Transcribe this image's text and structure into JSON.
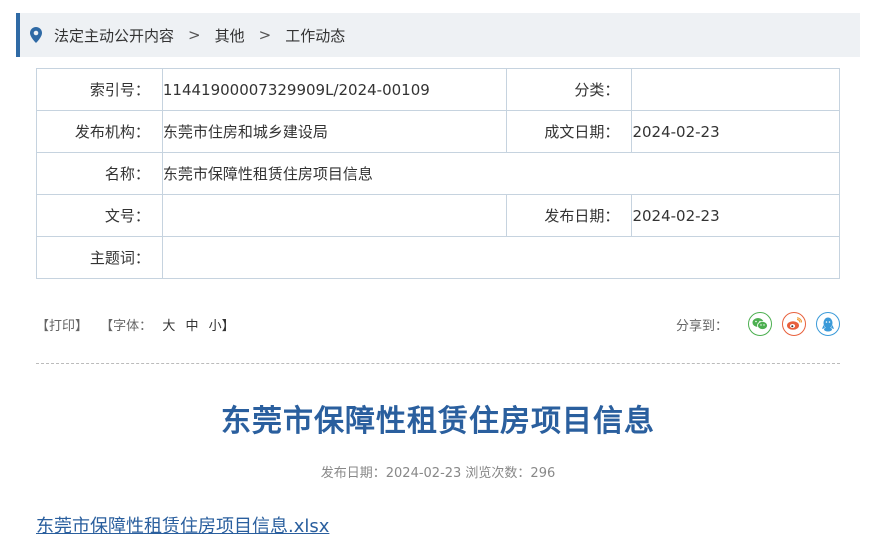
{
  "breadcrumb": {
    "items": [
      "法定主动公开内容",
      "其他",
      "工作动态"
    ],
    "separator": ">"
  },
  "info": {
    "index_label": "索引号：",
    "index_value": "11441900007329909L/2024-00109",
    "category_label": "分类：",
    "category_value": "",
    "publisher_label": "发布机构：",
    "publisher_value": "东莞市住房和城乡建设局",
    "created_label": "成文日期：",
    "created_value": "2024-02-23",
    "name_label": "名称：",
    "name_value": "东莞市保障性租赁住房项目信息",
    "docno_label": "文号：",
    "docno_value": "",
    "pubdate_label": "发布日期：",
    "pubdate_value": "2024-02-23",
    "keywords_label": "主题词：",
    "keywords_value": ""
  },
  "tools": {
    "print": "【打印】",
    "font_open": "【字体：",
    "font_large": "大",
    "font_medium": "中",
    "font_small": "小】",
    "share_label": "分享到："
  },
  "share_icons": [
    "wechat-icon",
    "weibo-icon",
    "qq-icon"
  ],
  "colors": {
    "accent": "#2f6aa5",
    "title": "#2a5f9e",
    "wechat": "#4caf50",
    "weibo": "#e8603c",
    "qq": "#3a9ad9"
  },
  "article": {
    "title": "东莞市保障性租赁住房项目信息",
    "meta": "发布日期：2024-02-23  浏览次数：296",
    "attachment": "东莞市保障性租赁住房项目信息.xlsx"
  }
}
